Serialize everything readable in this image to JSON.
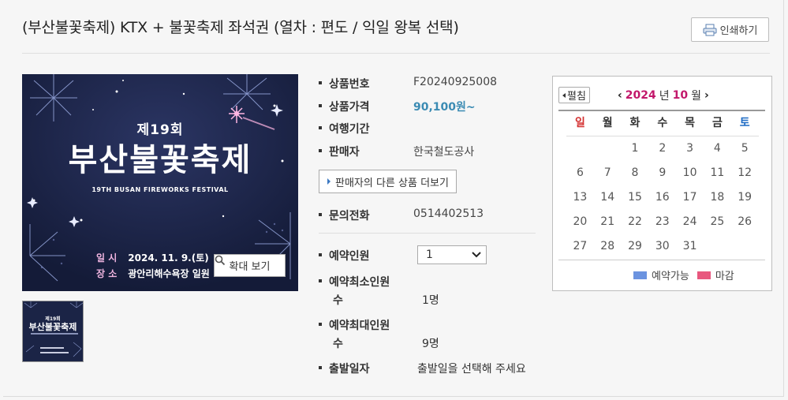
{
  "title": "(부산불꽃축제) KTX + 불꽃축제 좌석권 (열차 : 편도 / 익일 왕복 선택)",
  "print_button": "인쇄하기",
  "poster": {
    "edition": "제19회",
    "name": "부산불꽃축제",
    "english": "19TH BUSAN FIREWORKS FESTIVAL",
    "date_label": "일 시",
    "date_value": "2024. 11. 9.(토)",
    "place_label": "장 소",
    "place_value": "광안리해수욕장 일원"
  },
  "zoom_button": "확대 보기",
  "info": {
    "product_no_label": "상품번호",
    "product_no": "F20240925008",
    "price_label": "상품가격",
    "price": "90,100원~",
    "period_label": "여행기간",
    "period": "",
    "seller_label": "판매자",
    "seller": "한국철도공사",
    "seller_more": "판매자의 다른 상품 더보기",
    "phone_label": "문의전화",
    "phone": "0514402513",
    "persons_label": "예약인원",
    "persons_selected": "1",
    "min_label_1": "예약최소인원",
    "min_label_2": "수",
    "min_value": "1명",
    "max_label_1": "예약최대인원",
    "max_label_2": "수",
    "max_value": "9명",
    "depart_label": "출발일자",
    "depart_value": "출발일을 선택해 주세요"
  },
  "calendar": {
    "close": "펼침",
    "year": "2024",
    "year_suffix": "년",
    "month": "10",
    "month_suffix": "월",
    "weekdays": [
      "일",
      "월",
      "화",
      "수",
      "목",
      "금",
      "토"
    ],
    "weeks": [
      [
        "",
        "",
        "1",
        "2",
        "3",
        "4",
        "5"
      ],
      [
        "6",
        "7",
        "8",
        "9",
        "10",
        "11",
        "12"
      ],
      [
        "13",
        "14",
        "15",
        "16",
        "17",
        "18",
        "19"
      ],
      [
        "20",
        "21",
        "22",
        "23",
        "24",
        "25",
        "26"
      ],
      [
        "27",
        "28",
        "29",
        "30",
        "31",
        "",
        ""
      ]
    ],
    "legend_available": "예약가능",
    "legend_closed": "마감",
    "color_available": "#6b93e0",
    "color_closed": "#e8577e"
  },
  "colors": {
    "price": "#3b8bb3",
    "accent_month": "#c2186b"
  },
  "icons": {
    "print": "printer-icon",
    "zoom": "magnifier-icon"
  }
}
